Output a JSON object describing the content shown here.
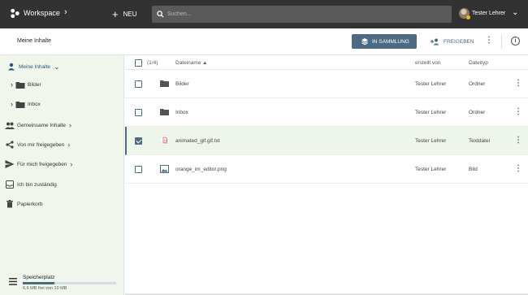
{
  "topbar": {
    "workspace_label": "Workspace",
    "new_label": "NEU",
    "search_placeholder": "Suchen...",
    "user_name": "Tester Lehrer"
  },
  "subbar": {
    "title": "Meine Inhalte",
    "collection_label": "IN SAMMLUNG",
    "share_label": "FREIGEBEN"
  },
  "sidebar": {
    "my_content": "Meine Inhalte",
    "folder_bilder": "Bilder",
    "folder_inbox": "Inbox",
    "shared_content": "Gemeinsame Inhalte",
    "shared_by_me": "Von mir freigegeben",
    "shared_with_me": "Für mich freigegeben",
    "responsible": "Ich bin zuständig",
    "trash": "Papierkorb"
  },
  "storage": {
    "title": "Speicherplatz",
    "text": "6,6 MB frei von 10 MB",
    "used_fraction": 0.34
  },
  "table": {
    "count": "(1/4)",
    "col_name": "Dateiname",
    "col_author": "erstellt von",
    "col_type": "Dateityp",
    "rows": [
      {
        "name": "Bilder",
        "author": "Tester Lehrer",
        "type": "Ordner"
      },
      {
        "name": "Inbox",
        "author": "Tester Lehrer",
        "type": "Ordner"
      },
      {
        "name": "animated_gif.gif.txt",
        "author": "Tester Lehrer",
        "type": "Textdatei"
      },
      {
        "name": "orange_im_editor.png",
        "author": "Tester Lehrer",
        "type": "Bild"
      }
    ]
  },
  "colors": {
    "topbar": "#323232",
    "accent": "#4c6a81",
    "sidebar_bg": "#f0f6ec"
  }
}
